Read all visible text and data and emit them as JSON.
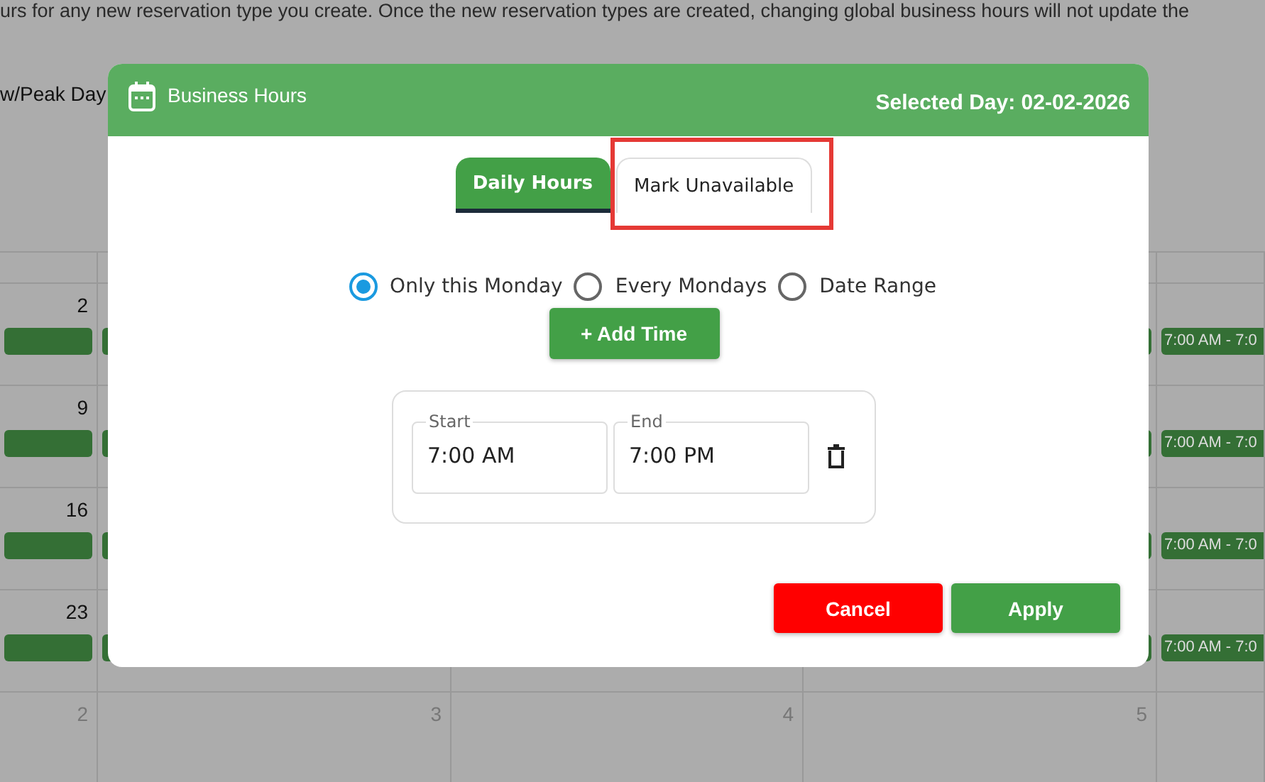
{
  "background": {
    "notice": "urs for any new reservation type you create. Once the new reservation types are created, changing global business hours will not update the",
    "column_label": "w/Peak Day",
    "weeks": [
      {
        "date": "2",
        "bar_label": "7:00 AM - 7:0"
      },
      {
        "date": "9",
        "bar_label": "7:00 AM - 7:0"
      },
      {
        "date": "16",
        "bar_label": "7:00 AM - 7:0"
      },
      {
        "date": "23",
        "bar_label": "7:00 AM - 7:0"
      }
    ],
    "next_month_dates": [
      "2",
      "3",
      "4",
      "5"
    ]
  },
  "dialog": {
    "title": "Business Hours",
    "selected_day": "Selected Day: 02-02-2026",
    "tabs": [
      {
        "label": "Daily Hours",
        "selected": true,
        "highlighted": false
      },
      {
        "label": "Mark Unavailable",
        "selected": false,
        "highlighted": true
      }
    ],
    "options": [
      {
        "label": "Only this Monday",
        "selected": true
      },
      {
        "label": "Every Mondays",
        "selected": false
      },
      {
        "label": "Date Range",
        "selected": false
      }
    ],
    "add_button": "+ Add Time",
    "time_slots": [
      {
        "start_label": "Start",
        "start": "7:00 AM",
        "end_label": "End",
        "end": "7:00 PM"
      }
    ],
    "buttons": [
      {
        "label": "Cancel",
        "kind": "danger"
      },
      {
        "label": "Apply",
        "kind": "primary"
      }
    ]
  }
}
